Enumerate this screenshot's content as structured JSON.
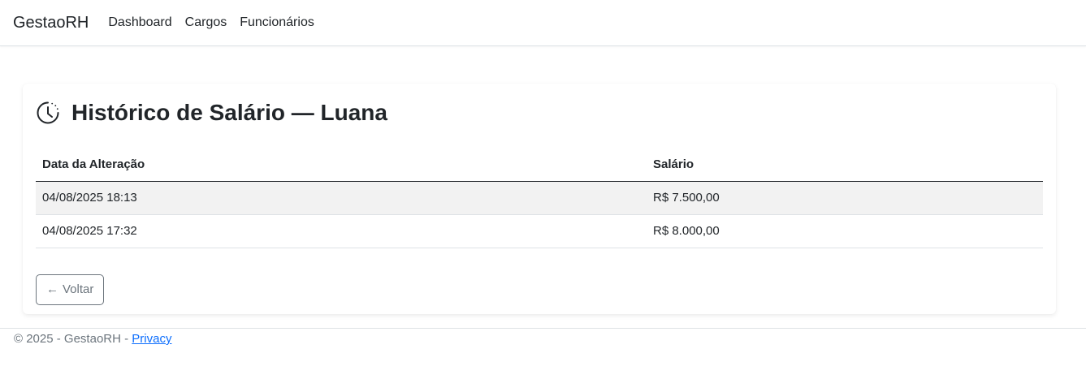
{
  "navbar": {
    "brand": "GestaoRH",
    "links": [
      {
        "label": "Dashboard"
      },
      {
        "label": "Cargos"
      },
      {
        "label": "Funcionários"
      }
    ]
  },
  "card": {
    "icon": "clock-history-icon",
    "title": "Histórico de Salário — Luana",
    "table": {
      "headers": [
        "Data da Alteração",
        "Salário"
      ],
      "rows": [
        [
          "04/08/2025 18:13",
          "R$ 7.500,00"
        ],
        [
          "04/08/2025 17:32",
          "R$ 8.000,00"
        ]
      ]
    },
    "back_button": {
      "arrow": "←",
      "label": "Voltar"
    }
  },
  "footer": {
    "text": "© 2025 - GestaoRH - ",
    "link": "Privacy"
  },
  "colors": {
    "link": "#0d6efd",
    "muted": "#6c757d",
    "stripe": "#f2f2f2",
    "text": "#212529"
  }
}
